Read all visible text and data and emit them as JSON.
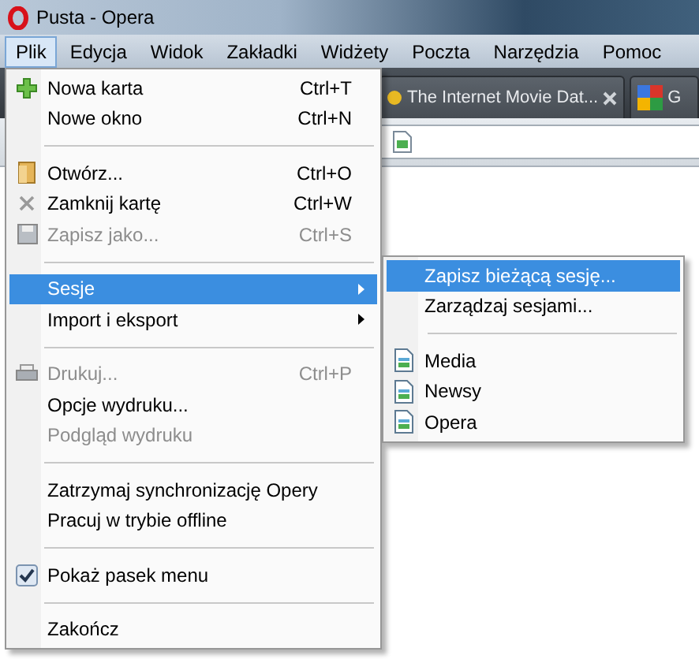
{
  "window": {
    "title": "Pusta - Opera"
  },
  "menu_bar": [
    {
      "label": "Plik",
      "selected": true
    },
    {
      "label": "Edycja",
      "selected": false
    },
    {
      "label": "Widok",
      "selected": false
    },
    {
      "label": "Zakładki",
      "selected": false
    },
    {
      "label": "Widżety",
      "selected": false
    },
    {
      "label": "Poczta",
      "selected": false
    },
    {
      "label": "Narzędzia",
      "selected": false
    },
    {
      "label": "Pomoc",
      "selected": false
    }
  ],
  "tabs": [
    {
      "title": "The Internet Movie Dat..."
    },
    {
      "title": "G"
    }
  ],
  "file_menu": [
    {
      "kind": "item",
      "label": "Nowa karta",
      "shortcut": "Ctrl+T",
      "disabled": false,
      "selected": false
    },
    {
      "kind": "item",
      "label": "Nowe okno",
      "shortcut": "Ctrl+N",
      "disabled": false,
      "selected": false
    },
    {
      "kind": "separator"
    },
    {
      "kind": "item",
      "label": "Otwórz...",
      "shortcut": "Ctrl+O",
      "disabled": false,
      "selected": false
    },
    {
      "kind": "item",
      "label": "Zamknij kartę",
      "shortcut": "Ctrl+W",
      "disabled": false,
      "selected": false
    },
    {
      "kind": "item",
      "label": "Zapisz jako...",
      "shortcut": "Ctrl+S",
      "disabled": true,
      "selected": false
    },
    {
      "kind": "separator"
    },
    {
      "kind": "submenu",
      "label": "Sesje",
      "disabled": false,
      "selected": true
    },
    {
      "kind": "submenu",
      "label": "Import i eksport",
      "disabled": false,
      "selected": false
    },
    {
      "kind": "separator"
    },
    {
      "kind": "item",
      "label": "Drukuj...",
      "shortcut": "Ctrl+P",
      "disabled": true,
      "selected": false
    },
    {
      "kind": "item",
      "label": "Opcje wydruku...",
      "disabled": false,
      "selected": false
    },
    {
      "kind": "item",
      "label": "Podgląd wydruku",
      "disabled": true,
      "selected": false
    },
    {
      "kind": "separator"
    },
    {
      "kind": "item",
      "label": "Zatrzymaj synchronizację Opery",
      "disabled": false,
      "selected": false
    },
    {
      "kind": "item",
      "label": "Pracuj w trybie offline",
      "disabled": false,
      "selected": false
    },
    {
      "kind": "separator"
    },
    {
      "kind": "check",
      "label": "Pokaż pasek menu",
      "checked": true,
      "disabled": false,
      "selected": false
    },
    {
      "kind": "separator"
    },
    {
      "kind": "item",
      "label": "Zakończ",
      "disabled": false,
      "selected": false
    }
  ],
  "sessions_menu": [
    {
      "kind": "item",
      "label": "Zapisz bieżącą sesję...",
      "selected": true
    },
    {
      "kind": "item",
      "label": "Zarządzaj sesjami...",
      "selected": false
    },
    {
      "kind": "separator"
    },
    {
      "kind": "session",
      "label": "Media",
      "selected": false
    },
    {
      "kind": "session",
      "label": "Newsy",
      "selected": false
    },
    {
      "kind": "session",
      "label": "Opera",
      "selected": false
    }
  ]
}
